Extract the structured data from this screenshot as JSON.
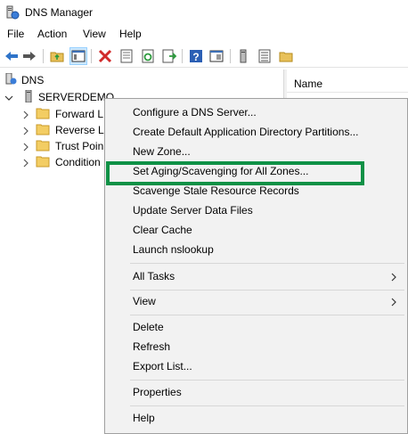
{
  "window": {
    "title": "DNS Manager",
    "icon": "dns-manager-icon"
  },
  "menubar": {
    "items": [
      "File",
      "Action",
      "View",
      "Help"
    ]
  },
  "toolbar": {
    "buttons": [
      "back-arrow-icon",
      "forward-arrow-icon",
      "up-folder-icon",
      "show-hide-tree-icon",
      "delete-icon",
      "properties-sheet-icon",
      "refresh-icon",
      "export-list-icon",
      "help-icon",
      "console-icon",
      "server-icon",
      "list-icon",
      "folder-icon"
    ]
  },
  "tree": {
    "root": "DNS",
    "server": "SERVERDEMO",
    "children": [
      "Forward L",
      "Reverse Lo",
      "Trust Poin",
      "Condition"
    ]
  },
  "right_pane": {
    "column_header": "Name"
  },
  "context_menu": {
    "items": [
      "Configure a DNS Server...",
      "Create Default Application Directory Partitions...",
      "New Zone...",
      "Set Aging/Scavenging for All Zones...",
      "Scavenge Stale Resource Records",
      "Update Server Data Files",
      "Clear Cache",
      "Launch nslookup",
      "All Tasks",
      "View",
      "Delete",
      "Refresh",
      "Export List...",
      "Properties",
      "Help"
    ]
  },
  "colors": {
    "highlight_box": "#0f9146",
    "selection": "#cce8ff",
    "menu_bg": "#f2f2f2"
  }
}
